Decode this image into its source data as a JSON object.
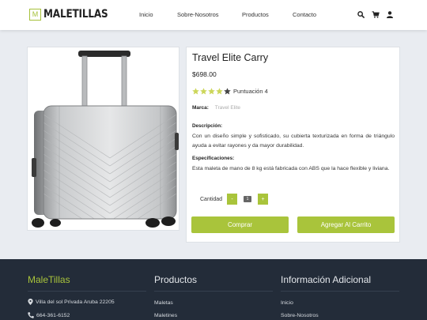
{
  "header": {
    "logo_letter": "M",
    "logo_text": "MALETILLAS",
    "nav": [
      "Inicio",
      "Sobre-Nosotros",
      "Productos",
      "Contacto"
    ],
    "icons": [
      "search-icon",
      "cart-icon",
      "user-icon"
    ]
  },
  "product": {
    "title": "Travel Elite Carry",
    "price": "$698.00",
    "rating": 4,
    "rating_label": "Puntuación 4",
    "brand_label": "Marca:",
    "brand_value": "Travel Elite",
    "description_label": "Descripción:",
    "description": "Con un diseño simple y sofisticado, su cubierta texturizada en forma de triángulo ayuda a evitar rayones y da mayor durabilidad.",
    "specs_label": "Especificaciones:",
    "specs": "Esta maleta de mano de 8 kg está fabricada con ABS que la hace flexible y liviana.",
    "quantity_label": "Cantidad",
    "quantity": "1",
    "minus": "-",
    "plus": "+",
    "buy_label": "Comprar",
    "add_cart_label": "Agregar Al Carrito"
  },
  "footer": {
    "brand": "MaleTillas",
    "address": "Villa del sol Privada Aruba 22205",
    "phone": "664-361-6152",
    "products_heading": "Productos",
    "products": [
      "Maletas",
      "Maletines"
    ],
    "info_heading": "Información Adicional",
    "info_links": [
      "Inicio",
      "Sobre-Nosotros"
    ]
  },
  "colors": {
    "accent": "#a9c43b",
    "footer_bg": "#232c39",
    "page_bg": "#e9ecf1"
  }
}
